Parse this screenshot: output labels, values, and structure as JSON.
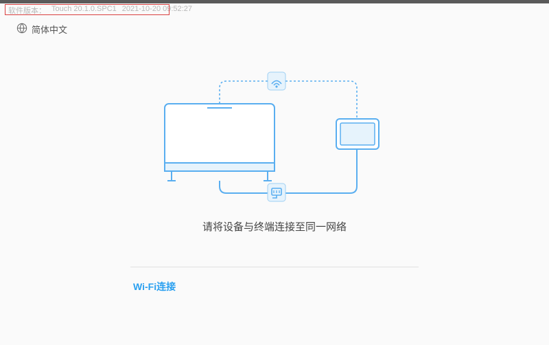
{
  "header": {
    "version_label": "软件版本：",
    "version_value": "Touch 20.1.0.SPC1",
    "timestamp": "2021-10-20 09:52:27"
  },
  "language": {
    "label": "简体中文"
  },
  "main": {
    "instruction": "请将设备与终端连接至同一网络",
    "wifi_label": "Wi-Fi连接"
  },
  "colors": {
    "accent": "#2aa0f0",
    "line": "#59aef0",
    "fill_light": "#e6f3fc"
  }
}
